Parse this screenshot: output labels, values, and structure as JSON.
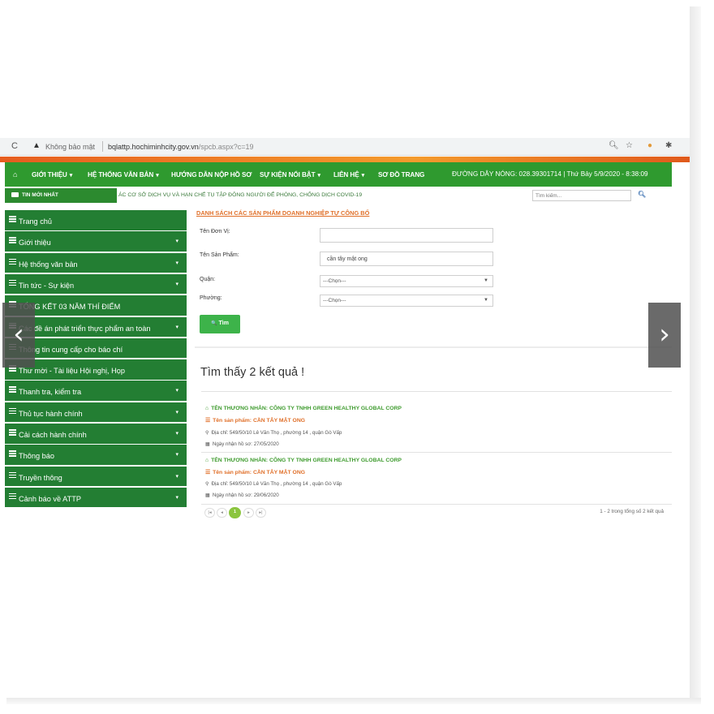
{
  "browser": {
    "reload_icon": "reload-icon",
    "warning_icon": "warning-icon",
    "security_label": "Không bảo mật",
    "url_host": "bqlattp.hochiminhcity.gov.vn",
    "url_path": "/spcb.aspx?c=19",
    "actions": [
      "zoom-icon",
      "star-icon",
      "extension-cookie-icon",
      "puzzle-icon"
    ]
  },
  "colors": {
    "nav_green": "#2f9a2f",
    "sidebar_green": "#237e33",
    "accent_orange": "#e0702a",
    "button_green": "#3db34a"
  },
  "nav": {
    "home_icon": "home-icon",
    "items": [
      {
        "label": "GIỚI THIỆU",
        "caret": "▾"
      },
      {
        "label": "HỆ THỐNG VĂN BẢN",
        "caret": "▾"
      },
      {
        "label": "HƯỚNG DẪN NỘP HỒ SƠ",
        "caret": ""
      },
      {
        "label": "SỰ KIỆN NỔI BẬT",
        "caret": "▾"
      },
      {
        "label": "LIÊN HỆ",
        "caret": "▾"
      },
      {
        "label": "SƠ ĐỒ TRANG",
        "caret": ""
      }
    ],
    "hotline": "ĐƯỜNG DÂY NÓNG: 028.39301714 | Thứ Bảy 5/9/2020 - 8:38:09"
  },
  "newsbar": {
    "label": "TIN MỚI NHẤT",
    "ticker": "ÁC CƠ SỞ DỊCH VỤ VÀ HẠN CHẾ TỤ TẬP ĐÔNG NGƯỜI ĐỂ PHÒNG, CHỐNG DỊCH COVID-19",
    "search_placeholder": "Tìm kiếm...",
    "search_icon": "search-icon"
  },
  "sidebar": {
    "items": [
      {
        "label": "Trang chủ",
        "caret": ""
      },
      {
        "label": "Giới thiệu",
        "caret": "▾"
      },
      {
        "label": "Hệ thống văn bản",
        "caret": "▾"
      },
      {
        "label": "Tin tức - Sự kiện",
        "caret": "▾"
      },
      {
        "label": "TỔNG KẾT 03 NĂM THÍ ĐIỂM",
        "caret": ""
      },
      {
        "label": "Các đề án phát triển thực phẩm an toàn",
        "caret": "▾"
      },
      {
        "label": "Thông tin cung cấp cho báo chí",
        "caret": ""
      },
      {
        "label": "Thư mời - Tài liệu Hội nghị, Họp",
        "caret": ""
      },
      {
        "label": "Thanh tra, kiểm tra",
        "caret": "▾"
      },
      {
        "label": "Thủ tục hành chính",
        "caret": "▾"
      },
      {
        "label": "Cải cách hành chính",
        "caret": "▾"
      },
      {
        "label": "Thông báo",
        "caret": "▾"
      },
      {
        "label": "Truyền thông",
        "caret": "▾"
      },
      {
        "label": "Cảnh báo về ATTP",
        "caret": "▾"
      }
    ]
  },
  "content": {
    "title": "DANH SÁCH CÁC SẢN PHẨM DOANH NGHIỆP TỰ CÔNG BỐ",
    "form": {
      "unit_label": "Tên Đơn Vị:",
      "unit_value": "",
      "product_label": "Tên Sản Phẩm:",
      "product_value": "cần tây mật ong",
      "district_label": "Quận:",
      "district_value": "---Chọn---",
      "ward_label": "Phường:",
      "ward_value": "---Chọn---",
      "search_button": "Tìm",
      "search_button_icon": "🔍"
    },
    "result_count": "Tìm thấy 2 kết quả !",
    "results": [
      {
        "merchant": "TÊN THƯƠNG NHÂN: CÔNG TY TNHH GREEN HEALTHY GLOBAL CORP",
        "product": "Tên sản phẩm: CẦN TÂY MẬT ONG",
        "address": "Địa chỉ: 549/50/10 Lê Văn Thọ , phường 14 , quận Gò Vấp",
        "date": "Ngày nhận hồ sơ: 27/05/2020"
      },
      {
        "merchant": "TÊN THƯƠNG NHÂN: CÔNG TY TNHH GREEN HEALTHY GLOBAL CORP",
        "product": "Tên sản phẩm: CẦN TÂY MẬT ONG",
        "address": "Địa chỉ: 549/50/10 Lê Văn Thọ , phường 14 , quận Gò Vấp",
        "date": "Ngày nhận hồ sơ: 29/06/2020"
      }
    ],
    "pager": {
      "first": "|◂",
      "prev": "◂",
      "current": "1",
      "next": "▸",
      "last": "▸|",
      "info": "1 - 2 trong tổng số 2 kết quả"
    }
  },
  "carousel": {
    "prev": "‹",
    "next": "›"
  }
}
